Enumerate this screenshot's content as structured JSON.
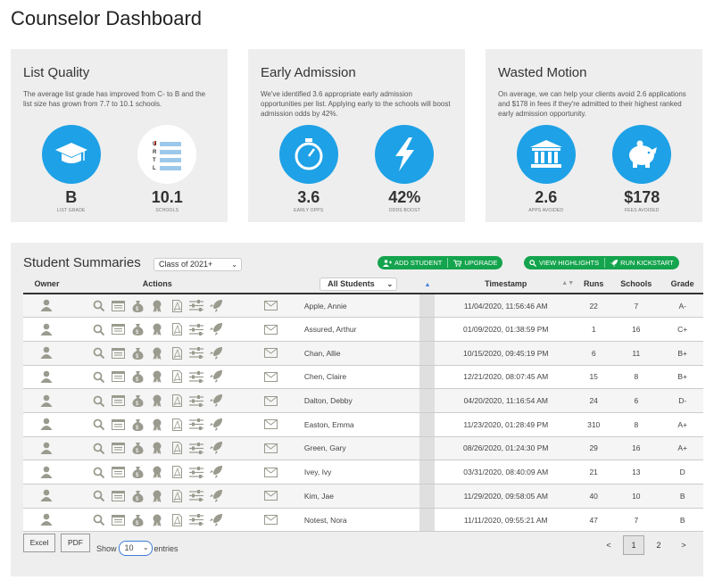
{
  "page_title": "Counselor Dashboard",
  "cards": [
    {
      "title": "List Quality",
      "text": "The average list grade has improved from C- to B and the list size has grown from 7.7 to 10.1 schools.",
      "metrics": [
        {
          "value": "B",
          "label": "LIST GRADE",
          "icon": "graduation-cap-icon"
        },
        {
          "value": "10.1",
          "label": "SCHOOLS",
          "icon": "list-urtl-icon",
          "letters": [
            "U",
            "R",
            "T",
            "L"
          ]
        }
      ]
    },
    {
      "title": "Early Admission",
      "text": "We've identified 3.6 appropriate early admission opportunities per list. Applying early to the schools will boost admission odds by 42%.",
      "metrics": [
        {
          "value": "3.6",
          "label": "EARLY OPPS",
          "icon": "stopwatch-icon"
        },
        {
          "value": "42%",
          "label": "ODDS BOOST",
          "icon": "lightning-icon"
        }
      ]
    },
    {
      "title": "Wasted Motion",
      "text": "On average, we can help your clients avoid 2.6 applications and $178 in fees if they're admitted to their highest ranked early admission opportunity.",
      "metrics": [
        {
          "value": "2.6",
          "label": "APPS AVOIDED",
          "icon": "institution-icon"
        },
        {
          "value": "$178",
          "label": "FEES AVOIDED",
          "icon": "piggy-bank-icon"
        }
      ]
    }
  ],
  "summaries": {
    "title": "Student Summaries",
    "class_select": "Class of 2021+",
    "buttons": {
      "add_student": "ADD STUDENT",
      "upgrade": "UPGRADE",
      "view_highlights": "VIEW HIGHLIGHTS",
      "run_kickstart": "RUN KICKSTART"
    },
    "columns": {
      "owner": "Owner",
      "actions": "Actions",
      "students_filter": "All Students",
      "timestamp": "Timestamp",
      "runs": "Runs",
      "schools": "Schools",
      "grade": "Grade"
    },
    "rows": [
      {
        "name": "Apple, Annie",
        "timestamp": "11/04/2020, 11:56:46 AM",
        "runs": "22",
        "schools": "7",
        "grade": "A-"
      },
      {
        "name": "Assured, Arthur",
        "timestamp": "01/09/2020, 01:38:59 PM",
        "runs": "1",
        "schools": "16",
        "grade": "C+"
      },
      {
        "name": "Chan, Allie",
        "timestamp": "10/15/2020, 09:45:19 PM",
        "runs": "6",
        "schools": "11",
        "grade": "B+"
      },
      {
        "name": "Chen, Claire",
        "timestamp": "12/21/2020, 08:07:45 AM",
        "runs": "15",
        "schools": "8",
        "grade": "B+"
      },
      {
        "name": "Dalton, Debby",
        "timestamp": "04/20/2020, 11:16:54 AM",
        "runs": "24",
        "schools": "6",
        "grade": "D-"
      },
      {
        "name": "Easton, Emma",
        "timestamp": "11/23/2020, 01:28:49 PM",
        "runs": "310",
        "schools": "8",
        "grade": "A+"
      },
      {
        "name": "Green, Gary",
        "timestamp": "08/26/2020, 01:24:30 PM",
        "runs": "29",
        "schools": "16",
        "grade": "A+"
      },
      {
        "name": "Ivey, Ivy",
        "timestamp": "03/31/2020, 08:40:09 AM",
        "runs": "21",
        "schools": "13",
        "grade": "D"
      },
      {
        "name": "Kim, Jae",
        "timestamp": "11/29/2020, 09:58:05 AM",
        "runs": "40",
        "schools": "10",
        "grade": "B"
      },
      {
        "name": "Notest, Nora",
        "timestamp": "11/11/2020, 09:55:21 AM",
        "runs": "47",
        "schools": "7",
        "grade": "B"
      }
    ],
    "footer": {
      "excel": "Excel",
      "pdf": "PDF",
      "show": "Show",
      "entries_value": "10",
      "entries": "entries",
      "pager": [
        "<",
        "1",
        "2",
        ">"
      ],
      "active_page": "1"
    },
    "colors": {
      "accent_blue": "#1ea1e6",
      "green": "#14a44d",
      "icon_gray": "#9a9a8e"
    }
  }
}
